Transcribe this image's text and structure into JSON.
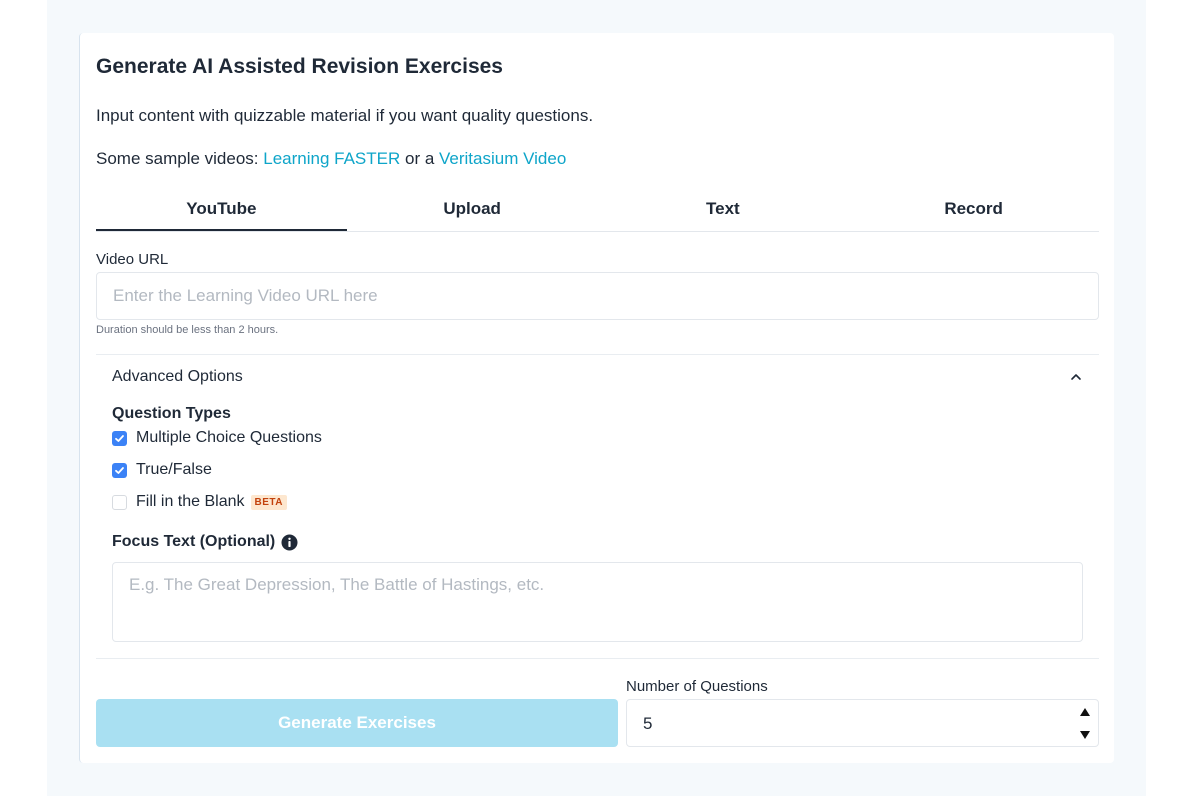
{
  "header": {
    "title": "Generate AI Assisted Revision Exercises",
    "intro": "Input content with quizzable material if you want quality questions.",
    "samples_prefix": "Some sample videos: ",
    "sample_link_1": "Learning FASTER",
    "samples_joiner": " or a ",
    "sample_link_2": "Veritasium Video"
  },
  "tabs": [
    {
      "label": "YouTube",
      "active": true
    },
    {
      "label": "Upload",
      "active": false
    },
    {
      "label": "Text",
      "active": false
    },
    {
      "label": "Record",
      "active": false
    }
  ],
  "video": {
    "label": "Video URL",
    "placeholder": "Enter the Learning Video URL here",
    "value": "",
    "hint": "Duration should be less than 2 hours."
  },
  "advanced": {
    "label": "Advanced Options",
    "expanded": true,
    "question_types_title": "Question Types",
    "question_types": [
      {
        "label": "Multiple Choice Questions",
        "checked": true
      },
      {
        "label": "True/False",
        "checked": true
      },
      {
        "label": "Fill in the Blank",
        "checked": false,
        "badge": "BETA"
      }
    ],
    "focus_title": "Focus Text (Optional)",
    "focus_placeholder": "E.g. The Great Depression, The Battle of Hastings, etc."
  },
  "footer": {
    "generate_label": "Generate Exercises",
    "num_questions_label": "Number of Questions",
    "num_questions_value": "5"
  },
  "colors": {
    "link": "#0ea5c9",
    "checkbox_on": "#3b82f6",
    "button_disabled": "#a9e0f2",
    "beta_bg": "#fde7cf",
    "beta_text": "#c2410c"
  }
}
